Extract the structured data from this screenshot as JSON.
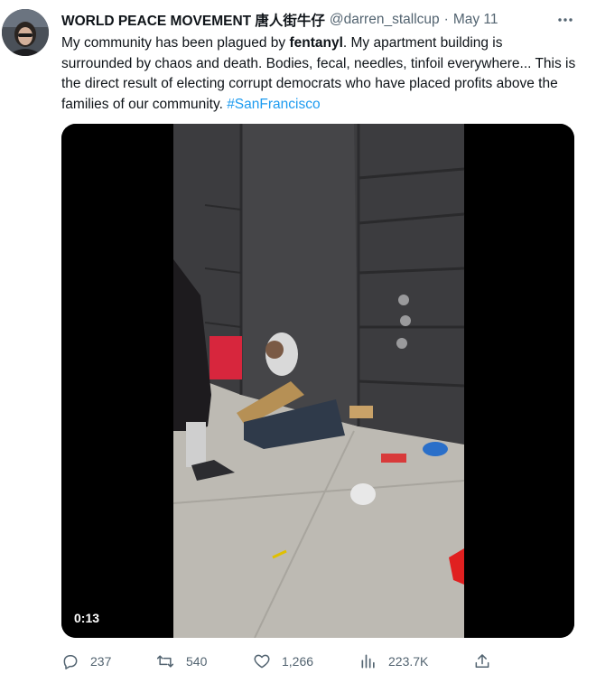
{
  "tweet": {
    "display_name": "WORLD PEACE MOVEMENT 唐人街牛仔",
    "handle": "@darren_stallcup",
    "separator": "·",
    "time": "May 11",
    "text": {
      "part1": "My community has been plagued by ",
      "bold": "fentanyl",
      "part2": ". My apartment building is surrounded by chaos and death. Bodies, fecal, needles, tinfoil everywhere... This is the direct result of electing corrupt democrats who have placed profits above the families of our community. ",
      "hashtag": "#SanFrancisco"
    },
    "video": {
      "duration": "0:13"
    },
    "actions": {
      "replies": "237",
      "retweets": "540",
      "likes": "1,266",
      "views": "223.7K"
    }
  },
  "icons": {
    "more": "more-dots-icon",
    "reply": "reply-icon",
    "retweet": "retweet-icon",
    "like": "heart-icon",
    "views": "views-chart-icon",
    "share": "share-icon"
  },
  "colors": {
    "text": "#0f1419",
    "secondary": "#536471",
    "link": "#1d9bf0"
  }
}
